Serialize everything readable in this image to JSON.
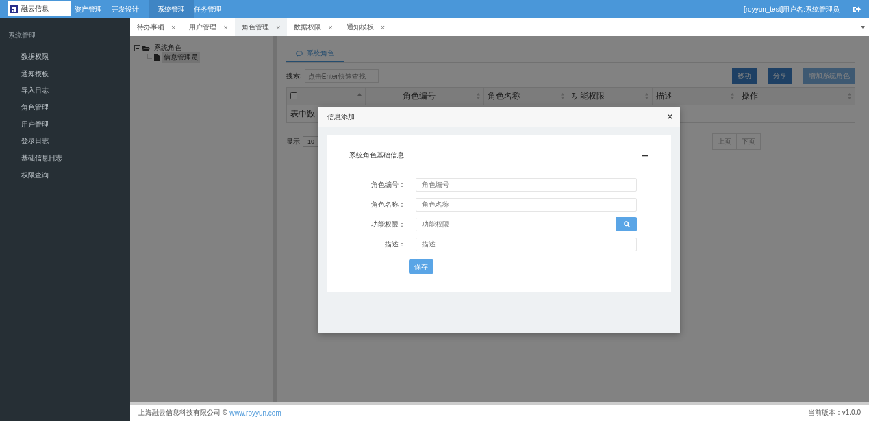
{
  "header": {
    "logo_text": "融云信息",
    "nav": [
      {
        "label": "资产管理",
        "selected": false
      },
      {
        "label": "开发设计",
        "selected": false
      },
      {
        "label": "系统管理",
        "selected": true
      },
      {
        "label": "任务管理",
        "selected": false
      }
    ],
    "user": "[royyun_test]用户名:系统管理员"
  },
  "sidebar": {
    "title": "系统管理",
    "items": [
      "数据权限",
      "通知模板",
      "导入日志",
      "角色管理",
      "用户管理",
      "登录日志",
      "基础信息日志",
      "权限查询"
    ]
  },
  "tabs": [
    {
      "label": "待办事项",
      "selected": false,
      "close": "×"
    },
    {
      "label": "用户管理",
      "selected": false,
      "close": "×"
    },
    {
      "label": "角色管理",
      "selected": true,
      "close": "×"
    },
    {
      "label": "数据权限",
      "selected": false,
      "close": "×"
    },
    {
      "label": "通知模板",
      "selected": false,
      "close": "×"
    }
  ],
  "tree": [
    {
      "label": "系统角色",
      "expanded": true,
      "selected": false,
      "children": [
        {
          "label": "信息管理员",
          "selected": true
        }
      ]
    }
  ],
  "main": {
    "panel_tab": "系统角色",
    "search_label": "搜索:",
    "search_placeholder": "点击Enter快速查找",
    "buttons": [
      {
        "label": "移动",
        "disabled": false
      },
      {
        "label": "分享",
        "disabled": false
      },
      {
        "label": "增加系统角色",
        "disabled": true
      }
    ],
    "table": {
      "columns": [
        {
          "kind": "checkbox",
          "checked": false
        },
        {
          "kind": "blank"
        },
        {
          "kind": "text",
          "label": "角色编号"
        },
        {
          "kind": "text",
          "label": "角色名称"
        },
        {
          "kind": "text",
          "label": "功能权限"
        },
        {
          "kind": "text",
          "label": "描述"
        },
        {
          "kind": "text",
          "label": "操作"
        }
      ],
      "empty_text": "表中数"
    },
    "page_size_label": "显示",
    "page_size": "10",
    "pager": [
      {
        "label": "上页",
        "disabled": true
      },
      {
        "label": "下页",
        "disabled": true
      }
    ]
  },
  "dialog": {
    "title": "信息添加",
    "close": "×",
    "section_title": "系统角色基础信息",
    "expanded": true,
    "fields": [
      {
        "kind": "text",
        "label": "角色编号：",
        "placeholder": "角色编号"
      },
      {
        "kind": "text",
        "label": "角色名称：",
        "placeholder": "角色名称"
      },
      {
        "kind": "lookup",
        "label": "功能权限：",
        "placeholder": "功能权限"
      },
      {
        "kind": "text",
        "label": "描述：",
        "placeholder": "描述"
      }
    ],
    "save": "保存"
  },
  "footer": {
    "company": "上海融云信息科技有限公司 ©",
    "link": "www.royyun.com",
    "version": "当前版本：v1.0.0"
  }
}
